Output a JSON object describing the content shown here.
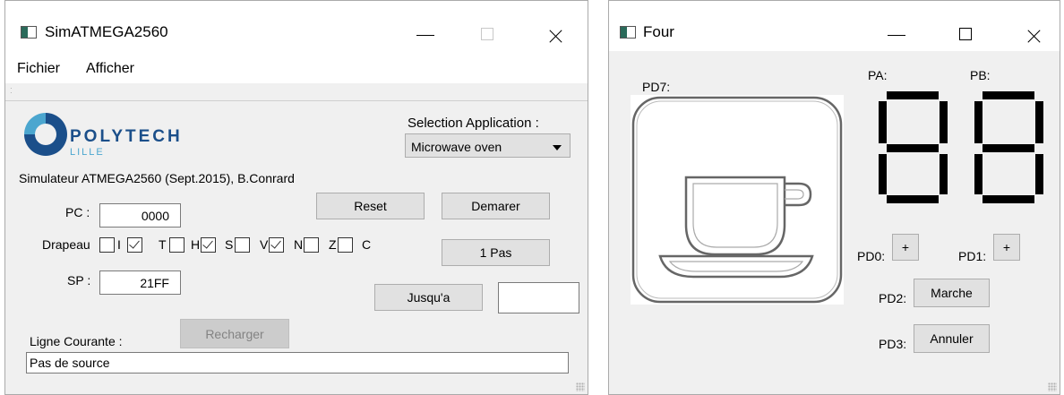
{
  "sim_window": {
    "title": "SimATMEGA2560",
    "menu": [
      "Fichier",
      "Afficher"
    ],
    "logo": {
      "name": "POLYTECH",
      "sub": "LILLE"
    },
    "selection_label": "Selection Application :",
    "selection_value": "Microwave oven",
    "subtitle": "Simulateur ATMEGA2560 (Sept.2015), B.Conrard",
    "pc_label": "PC :",
    "pc_value": "0000",
    "reset_label": "Reset",
    "start_label": "Demarer",
    "flags_label": "Drapeau",
    "flags": [
      {
        "name": "I",
        "checked": false
      },
      {
        "name": "T",
        "checked": true
      },
      {
        "name": "H",
        "checked": false
      },
      {
        "name": "S",
        "checked": true
      },
      {
        "name": "V",
        "checked": false
      },
      {
        "name": "N",
        "checked": true
      },
      {
        "name": "Z",
        "checked": false
      },
      {
        "name": "C",
        "checked": false
      }
    ],
    "step_label": "1 Pas",
    "sp_label": "SP :",
    "sp_value": "21FF",
    "until_label": "Jusqu'a",
    "until_value": "",
    "reload_label": "Recharger",
    "current_line_label": "Ligne Courante :",
    "current_line_value": "Pas de source"
  },
  "four_window": {
    "title": "Four",
    "pd7_label": "PD7:",
    "pa_label": "PA:",
    "pb_label": "PB:",
    "pd0_label": "PD0:",
    "pd0_button": "+",
    "pd1_label": "PD1:",
    "pd1_button": "+",
    "pd2_label": "PD2:",
    "pd2_button": "Marche",
    "pd3_label": "PD3:",
    "pd3_button": "Annuler"
  },
  "icons": [
    "app-icon",
    "minimize-icon",
    "maximize-icon",
    "close-icon",
    "polytech-logo-icon",
    "dropdown-arrow-icon",
    "coffee-cup-icon",
    "seven-segment-display",
    "resize-grip-icon"
  ],
  "colors": {
    "logo_blue": "#1b4f8a",
    "logo_light": "#4ba6cf",
    "segment": "#000000"
  }
}
